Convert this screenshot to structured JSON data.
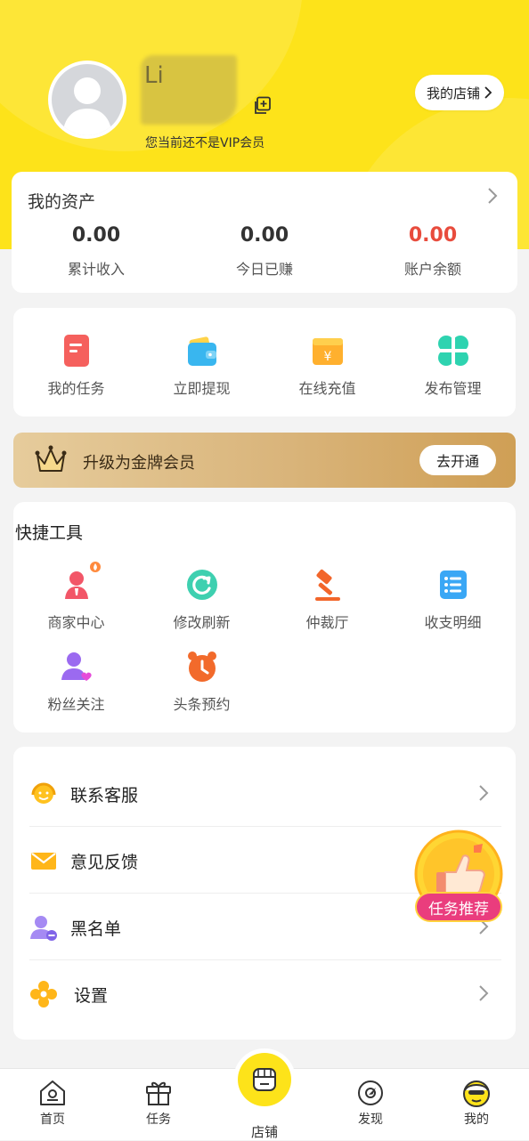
{
  "profile": {
    "username": "Li",
    "vip_status": "您当前还不是VIP会员",
    "shop_button": "我的店铺"
  },
  "assets": {
    "title": "我的资产",
    "stats": [
      {
        "value": "0.00",
        "label": "累计收入",
        "color": "#333333"
      },
      {
        "value": "0.00",
        "label": "今日已赚",
        "color": "#333333"
      },
      {
        "value": "0.00",
        "label": "账户余额",
        "color": "#e84c3d"
      }
    ]
  },
  "quick_actions": [
    {
      "label": "我的任务",
      "icon": "task-note-icon"
    },
    {
      "label": "立即提现",
      "icon": "wallet-icon"
    },
    {
      "label": "在线充值",
      "icon": "yuan-card-icon"
    },
    {
      "label": "发布管理",
      "icon": "clover-grid-icon"
    }
  ],
  "upgrade_banner": {
    "text": "升级为金牌会员",
    "button": "去开通"
  },
  "tools": {
    "title": "快捷工具",
    "items": [
      {
        "label": "商家中心",
        "icon": "merchant-icon"
      },
      {
        "label": "修改刷新",
        "icon": "refresh-icon"
      },
      {
        "label": "仲裁厅",
        "icon": "gavel-icon"
      },
      {
        "label": "收支明细",
        "icon": "list-icon"
      },
      {
        "label": "粉丝关注",
        "icon": "fans-icon"
      },
      {
        "label": "头条预约",
        "icon": "alarm-clock-icon"
      }
    ]
  },
  "menu": [
    {
      "label": "联系客服",
      "icon": "customer-service-icon"
    },
    {
      "label": "意见反馈",
      "icon": "envelope-icon"
    },
    {
      "label": "黑名单",
      "icon": "blacklist-user-icon"
    },
    {
      "label": "设置",
      "icon": "settings-flower-icon"
    }
  ],
  "floating_badge": {
    "label": "任务推荐"
  },
  "tabbar": [
    {
      "label": "首页",
      "icon": "home-icon"
    },
    {
      "label": "任务",
      "icon": "gift-box-icon"
    },
    {
      "label": "店铺",
      "icon": "shop-icon"
    },
    {
      "label": "发现",
      "icon": "compass-icon"
    },
    {
      "label": "我的",
      "icon": "profile-face-icon"
    }
  ],
  "colors": {
    "header": "#fde31a",
    "balance_red": "#e84c3d",
    "badge_pink": "#ea3d7d"
  }
}
